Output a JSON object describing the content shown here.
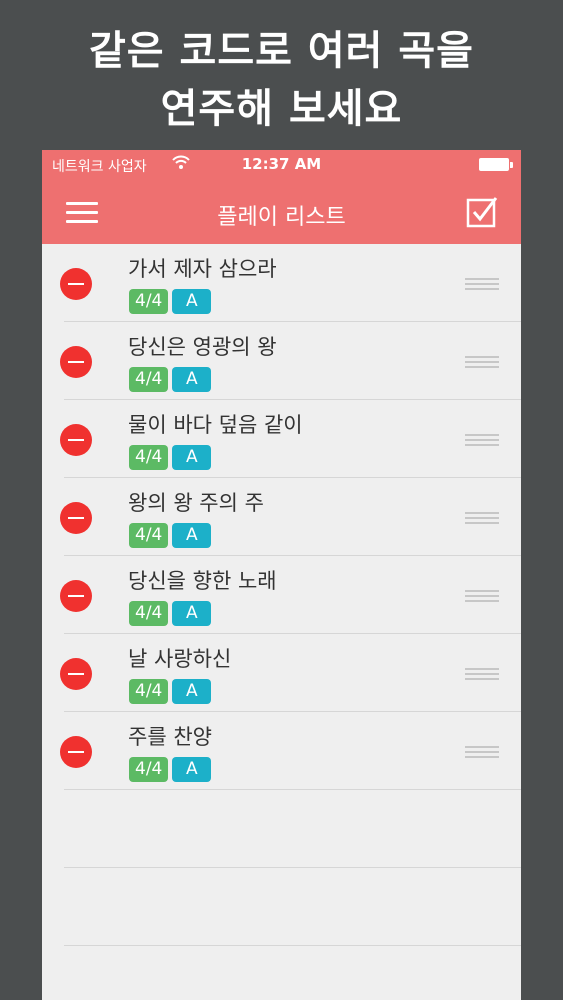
{
  "headline": {
    "line1": "같은 코드로 여러 곡을",
    "line2": "연주해 보세요"
  },
  "status_bar": {
    "carrier": "네트워크 사업자",
    "time": "12:37 AM"
  },
  "nav_bar": {
    "title": "플레이 리스트",
    "menu_icon": "hamburger-menu-icon",
    "action_icon": "checkbox-checked-icon"
  },
  "colors": {
    "accent": "#ee7070",
    "delete": "#f0312f",
    "time_badge": "#5cba64",
    "key_badge": "#1cb0c9"
  },
  "songs": [
    {
      "title": "가서 제자 삼으라",
      "time_signature": "4/4",
      "key": "A"
    },
    {
      "title": "당신은 영광의 왕",
      "time_signature": "4/4",
      "key": "A"
    },
    {
      "title": "물이 바다 덮음 같이",
      "time_signature": "4/4",
      "key": "A"
    },
    {
      "title": "왕의 왕 주의 주",
      "time_signature": "4/4",
      "key": "A"
    },
    {
      "title": "당신을 향한 노래",
      "time_signature": "4/4",
      "key": "A"
    },
    {
      "title": "날 사랑하신",
      "time_signature": "4/4",
      "key": "A"
    },
    {
      "title": "주를 찬양",
      "time_signature": "4/4",
      "key": "A"
    }
  ]
}
